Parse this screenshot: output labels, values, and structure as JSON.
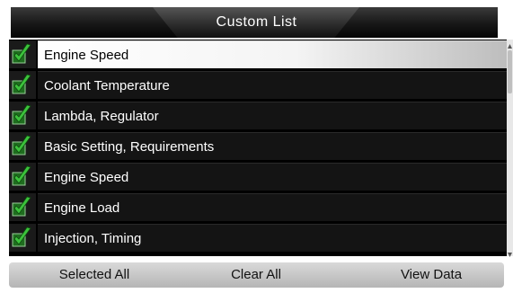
{
  "header": {
    "title": "Custom  List"
  },
  "list": {
    "items": [
      {
        "label": "Engine Speed",
        "checked": true,
        "selected": true
      },
      {
        "label": "Coolant Temperature",
        "checked": true,
        "selected": false
      },
      {
        "label": "Lambda, Regulator",
        "checked": true,
        "selected": false
      },
      {
        "label": "Basic Setting, Requirements",
        "checked": true,
        "selected": false
      },
      {
        "label": "Engine Speed",
        "checked": true,
        "selected": false
      },
      {
        "label": "Engine Load",
        "checked": true,
        "selected": false
      },
      {
        "label": "Injection, Timing",
        "checked": true,
        "selected": false
      }
    ]
  },
  "footer": {
    "select_all_label": "Selected  All",
    "clear_all_label": "Clear  All",
    "view_data_label": "View Data"
  },
  "icons": {
    "checkbox": "checkmark-icon",
    "scroll_up": "arrow-up-icon",
    "scroll_down": "arrow-down-icon"
  },
  "colors": {
    "check_green": "#2e9e2e",
    "selected_row": "#ffffff",
    "row_bg": "#141414"
  }
}
